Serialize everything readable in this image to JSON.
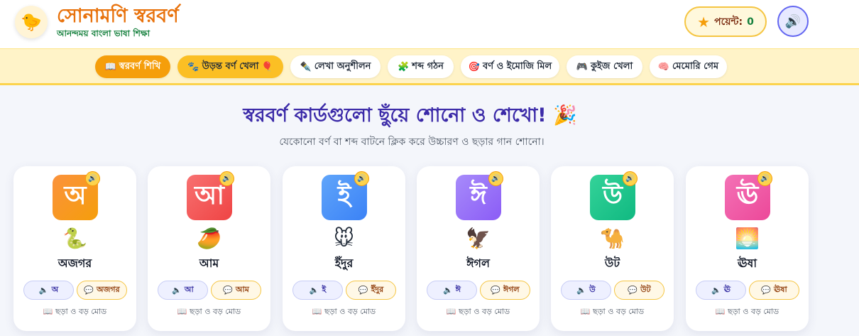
{
  "header": {
    "logo_icon": "🐤",
    "title": "সোনামণি স্বরবর্ণ",
    "subtitle": "আনন্দময় বাংলা ভাষা শিক্ষা",
    "points_label": "পয়েন্ট:",
    "points_value": "0",
    "star_icon": "★",
    "sound_icon": "🔊"
  },
  "nav": {
    "tabs": [
      {
        "icon": "📖",
        "label": "স্বরবর্ণ শিখি"
      },
      {
        "icon": "🐾",
        "label": "উড়ন্ত বর্ণ খেলা",
        "trail_icon": "🎈"
      },
      {
        "icon": "✒️",
        "label": "লেখা অনুশীলন"
      },
      {
        "icon": "🧩",
        "label": "শব্দ গঠন"
      },
      {
        "icon": "🎯",
        "label": "বর্ণ ও ইমোজি মিল"
      },
      {
        "icon": "🎮",
        "label": "কুইজ খেলা"
      },
      {
        "icon": "🧠",
        "label": "মেমোরি গেম"
      }
    ]
  },
  "main": {
    "title": "স্বরবর্ণ কার্ডগুলো ছুঁয়ে শোনো ও শেখো! 🎉",
    "subtitle": "যেকোনো বর্ণ বা শব্দ বাটনে ক্লিক করে উচ্চারণ ও ছড়ার গান শোনো।"
  },
  "cards": [
    {
      "letter": "অ",
      "emoji": "🐍",
      "word": "অজগর",
      "btn_letter": "অ",
      "btn_word": "অজগর",
      "rhyme": "ছড়া ও বড় মোড"
    },
    {
      "letter": "আ",
      "emoji": "🥭",
      "word": "আম",
      "btn_letter": "আ",
      "btn_word": "আম",
      "rhyme": "ছড়া ও বড় মোড"
    },
    {
      "letter": "ই",
      "emoji": "🐭",
      "word": "ইঁদুর",
      "btn_letter": "ই",
      "btn_word": "ইঁদুর",
      "rhyme": "ছড়া ও বড় মোড"
    },
    {
      "letter": "ঈ",
      "emoji": "🦅",
      "word": "ঈগল",
      "btn_letter": "ঈ",
      "btn_word": "ঈগল",
      "rhyme": "ছড়া ও বড় মোড"
    },
    {
      "letter": "উ",
      "emoji": "🐪",
      "word": "উট",
      "btn_letter": "উ",
      "btn_word": "উট",
      "rhyme": "ছড়া ও বড় মোড"
    },
    {
      "letter": "ঊ",
      "emoji": "🌅",
      "word": "ঊষা",
      "btn_letter": "ঊ",
      "btn_word": "ঊষা",
      "rhyme": "ছড়া ও বড় মোড"
    }
  ],
  "icons": {
    "speaker_small": "🔊",
    "speaker_btn": "🔈",
    "chat_btn": "💬",
    "book": "📖"
  }
}
